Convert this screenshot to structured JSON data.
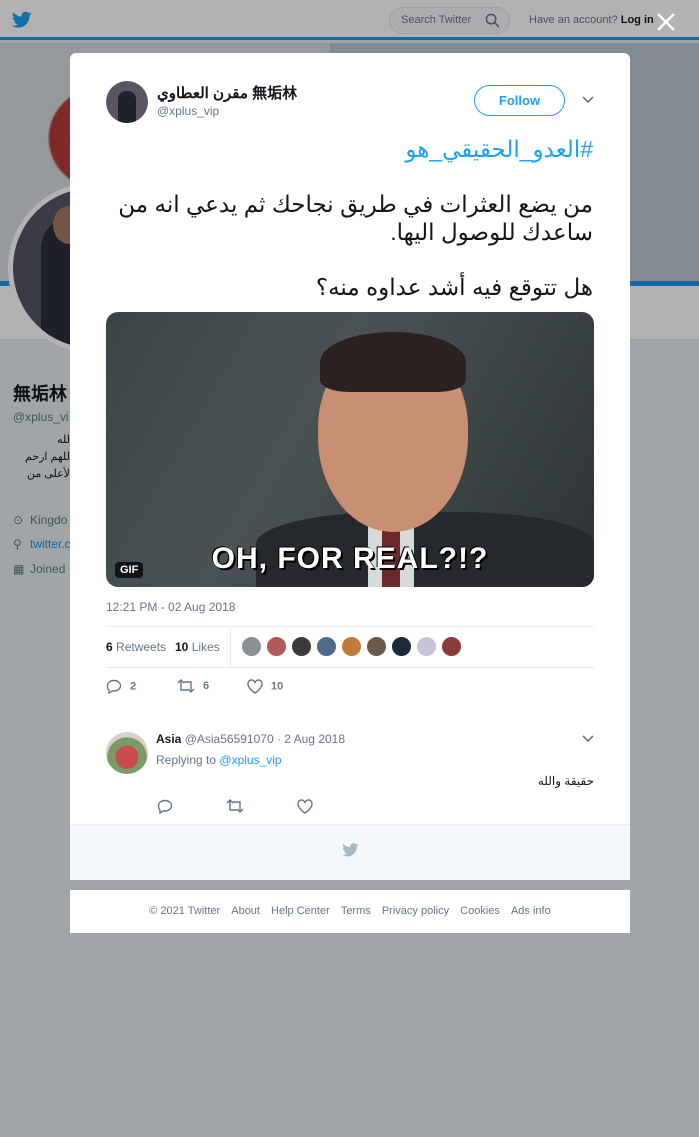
{
  "topbar": {
    "search_placeholder": "Search Twitter",
    "account_prompt": "Have an account?",
    "login_label": "Log in"
  },
  "profile": {
    "name": "無垢林",
    "handle": "@xplus_vi",
    "bio_lines": [
      "الله",
      "اللهم ارحم",
      "الأعلى من"
    ],
    "location": "Kingdo",
    "link": "twitter.c",
    "joined": "Joined"
  },
  "tweet": {
    "author_name": "مقرن العطاوي 無垢林",
    "author_handle": "@xplus_vip",
    "follow_label": "Follow",
    "hashtag": "#العدو_الحقيقي_هو",
    "paragraph1": "من يضع العثرات في طريق نجاحك ثم يدعي انه من ساعدك للوصول اليها.",
    "paragraph2": "هل تتوقع فيه أشد عداوه منه؟",
    "media_caption": "OH, FOR REAL?!?",
    "media_badge": "GIF",
    "timestamp": "12:21 PM - 02 Aug 2018",
    "retweets_count": "6",
    "retweets_label": "Retweets",
    "likes_count": "10",
    "likes_label": "Likes",
    "reply_count": "2",
    "retweet_count_action": "6",
    "like_count_action": "10"
  },
  "reply": {
    "name": "Asia",
    "handle_date": "@Asia56591070 · 2 Aug 2018",
    "replying_prefix": "Replying to",
    "replying_to": "@xplus_vip",
    "text": "حقيقة والله"
  },
  "footer": {
    "copyright": "© 2021 Twitter",
    "about": "About",
    "help": "Help Center",
    "terms": "Terms",
    "privacy": "Privacy policy",
    "cookies": "Cookies",
    "ads": "Ads info"
  },
  "colors": {
    "accent": "#1da1f2",
    "text": "#14171a",
    "muted": "#657786"
  },
  "icons": [
    "twitter-bird-icon",
    "search-icon",
    "close-icon",
    "chevron-down-icon",
    "reply-icon",
    "retweet-icon",
    "like-icon",
    "location-icon",
    "link-icon",
    "calendar-icon"
  ]
}
